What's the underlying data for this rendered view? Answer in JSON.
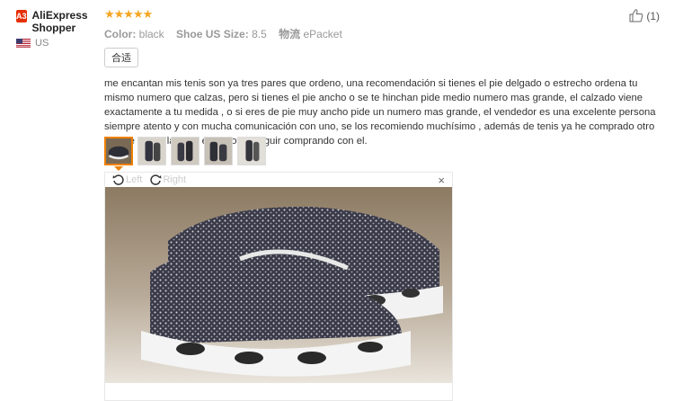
{
  "reviewer": {
    "badge": "A3",
    "name": "AliExpress Shopper",
    "country": "US"
  },
  "rating": {
    "stars": 5,
    "stars_text": "★★★★★"
  },
  "attributes": [
    {
      "label": "Color:",
      "value": "black"
    },
    {
      "label": "Shoe US Size:",
      "value": "8.5"
    },
    {
      "label": "物流",
      "value": "ePacket"
    }
  ],
  "fit_tag": "合适",
  "review_text": "me encantan mis tenis son ya tres pares que ordeno, una recomendación si tienes el pie delgado o estrecho ordena tu mismo numero que calzas, pero si tienes el pie ancho o se te hinchan pide medio numero mas grande, el calzado viene exactamente a tu medida , o si eres de pie muy ancho pide un numero mas grande, el vendedor es una excelente persona siempre atento y con mucha comunicación con uno, se los recomiendo muchísimo , además de tenis ya he comprado otro tipo de zapatillas con el , y voy a seguir comprando con el.",
  "helpful": {
    "count": "(1)"
  },
  "thumbnails": {
    "count": 5,
    "active": 0
  },
  "viewer": {
    "rotate_left": "Left",
    "rotate_right": "Right",
    "close": "×"
  },
  "colors": {
    "badge": "#e62e04",
    "stars": "#f5a623",
    "active_thumb": "#f08000"
  }
}
